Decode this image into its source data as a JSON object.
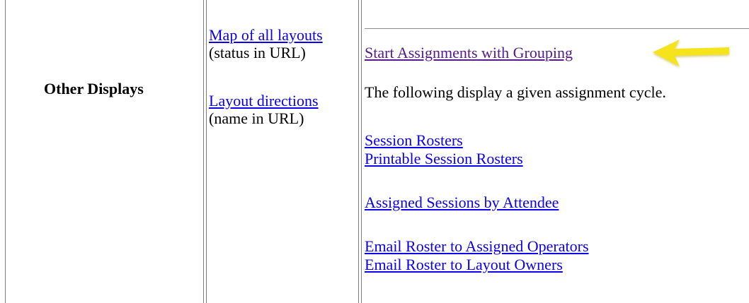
{
  "row_label": "Other Displays",
  "layouts_column": {
    "items": [
      {
        "link": "Map of all layouts",
        "note": "(status in URL)"
      },
      {
        "link": "Layout directions",
        "note": "(name in URL)"
      }
    ]
  },
  "displays_column": {
    "start_grouping_link": "Start Assignments with Grouping",
    "cycle_description": "The following display a given assignment cycle.",
    "links": {
      "session_rosters": "Session Rosters",
      "printable_session_rosters": "Printable Session Rosters",
      "assigned_by_attendee": "Assigned Sessions by Attendee",
      "email_operators": "Email Roster to Assigned Operators",
      "email_owners": "Email Roster to Layout Owners"
    }
  },
  "colors": {
    "link": "#0b00ee",
    "visited_link": "#551a8b",
    "arrow": "#f5e31f"
  }
}
